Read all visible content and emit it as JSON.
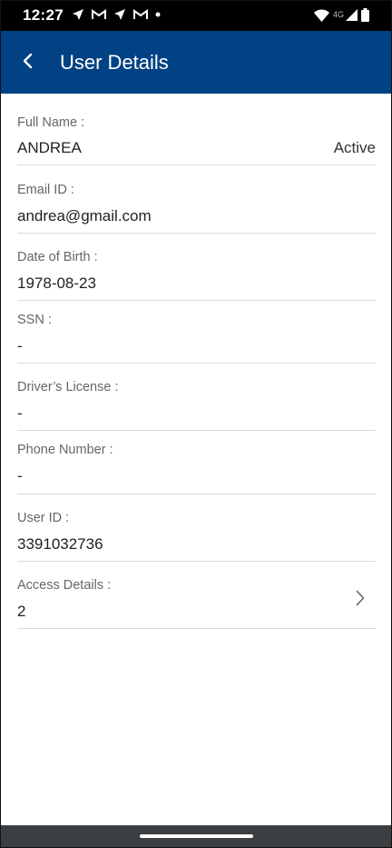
{
  "status_bar": {
    "time": "12:27",
    "network": "4G",
    "left_icons": [
      "navigation-icon",
      "gmail-icon",
      "navigation-icon",
      "gmail-icon",
      "dot-icon"
    ],
    "right_icons": [
      "wifi-icon",
      "signal-icon",
      "battery-icon"
    ]
  },
  "app_bar": {
    "title": "User Details",
    "back_icon": "chevron-left-icon"
  },
  "colors": {
    "app_bar_bg": "#004283",
    "status_bar_bg": "#000000",
    "label_color": "#666666",
    "divider": "#dadada"
  },
  "fields": {
    "full_name": {
      "label": "Full Name :",
      "value": "ANDREA",
      "status": "Active"
    },
    "email": {
      "label": "Email ID  :",
      "value": "andrea@gmail.com"
    },
    "dob": {
      "label": "Date of Birth  :",
      "value": "1978-08-23"
    },
    "ssn": {
      "label": "SSN  :",
      "value": "-"
    },
    "drivers_license": {
      "label": "Driver’s License :",
      "value": "-"
    },
    "phone": {
      "label": "Phone Number  :",
      "value": "-"
    },
    "user_id": {
      "label": "User ID :",
      "value": "3391032736"
    },
    "access_details": {
      "label": "Access Details :",
      "value": "2",
      "icon": "chevron-right-icon"
    }
  }
}
